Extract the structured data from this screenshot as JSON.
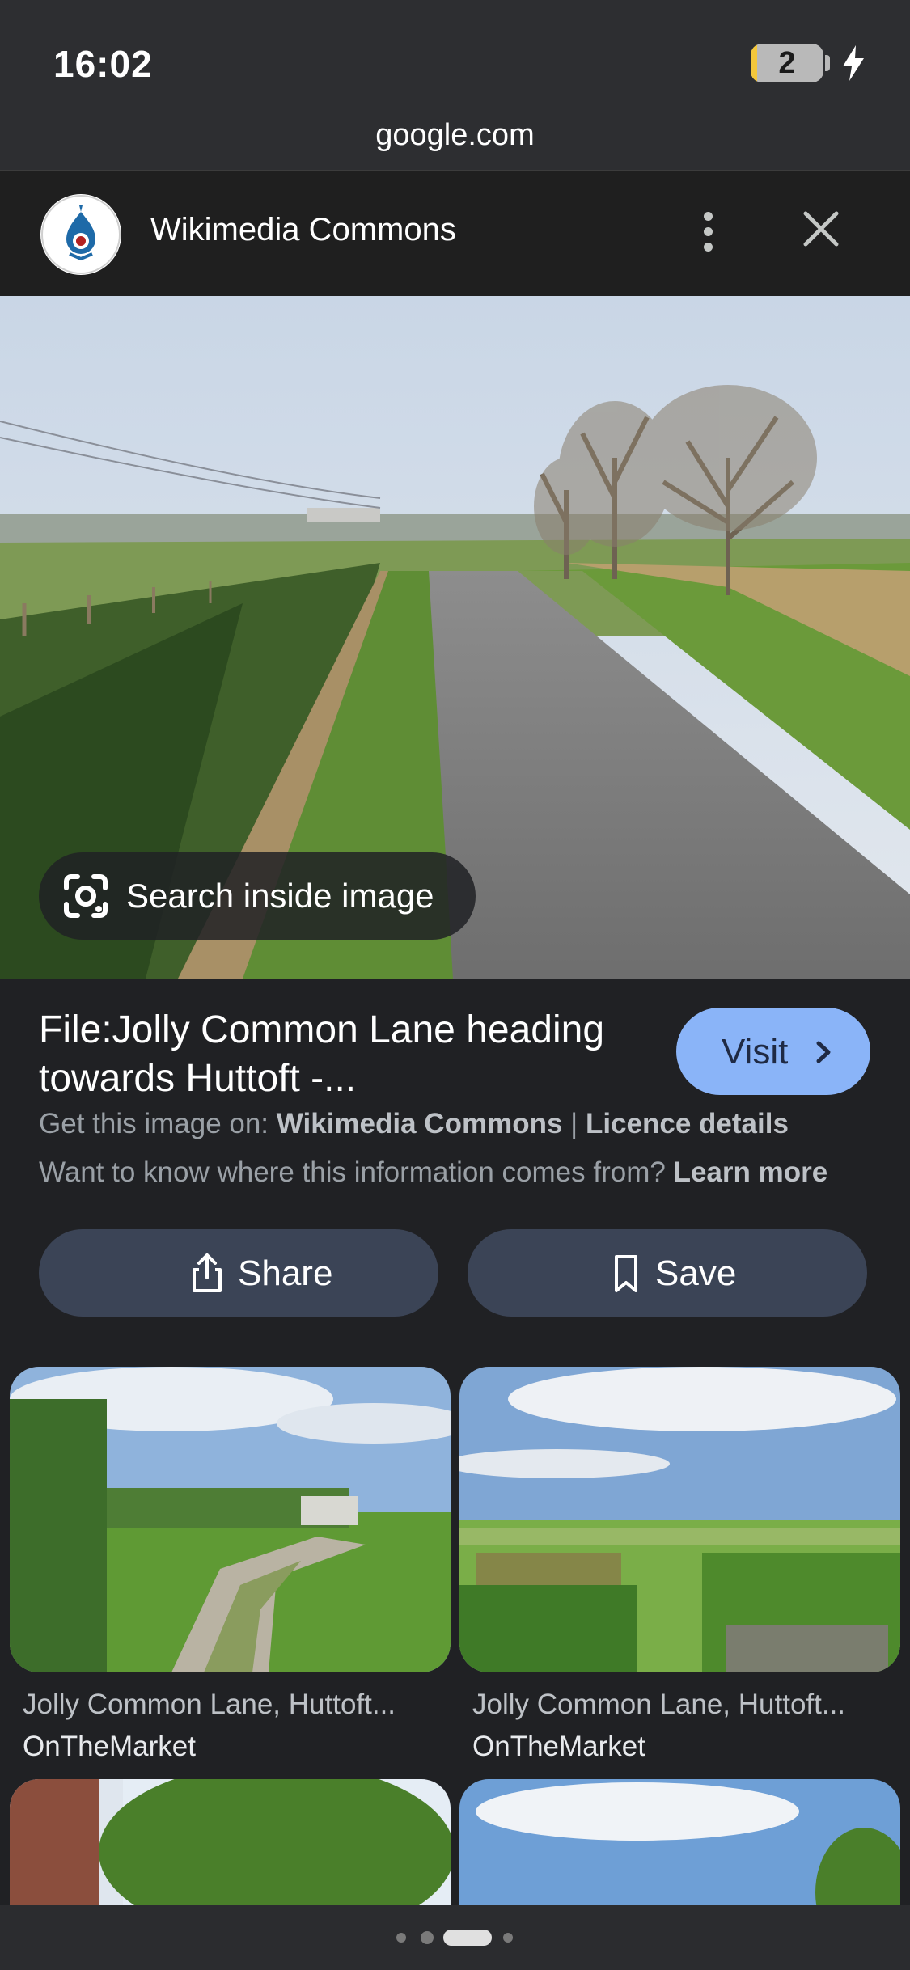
{
  "status_bar": {
    "time": "16:02",
    "battery_level": "2"
  },
  "browser": {
    "url": "google.com"
  },
  "source_header": {
    "title": "Wikimedia Commons",
    "logo_icon": "wikimedia-commons-logo"
  },
  "hero": {
    "search_chip_label": "Search inside image"
  },
  "result": {
    "title": "File:Jolly Common Lane heading towards Huttoft -...",
    "visit_label": "Visit",
    "get_image_prefix": "Get this image on:",
    "get_image_source": "Wikimedia Commons",
    "separator": "|",
    "licence_label": "Licence details",
    "info_question": "Want to know where this information comes from?",
    "learn_more": "Learn more"
  },
  "actions": {
    "share_label": "Share",
    "save_label": "Save"
  },
  "related": [
    {
      "caption": "Jolly Common Lane, Huttoft...",
      "source": "OnTheMarket"
    },
    {
      "caption": "Jolly Common Lane, Huttoft...",
      "source": "OnTheMarket"
    }
  ],
  "pager": {
    "total_pages": 4,
    "active_index": 2
  },
  "colors": {
    "accent": "#8ab4f8",
    "button_bg": "#3b4456",
    "background": "#202124"
  }
}
